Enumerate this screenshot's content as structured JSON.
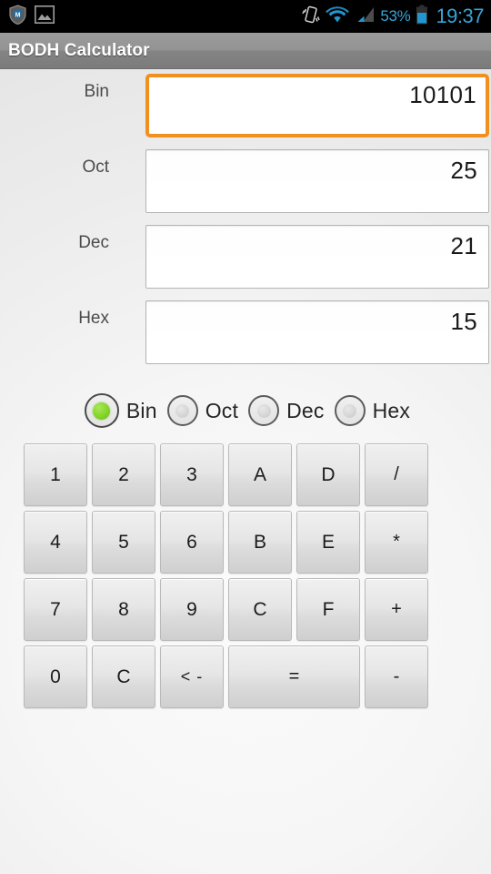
{
  "statusbar": {
    "left_icons": [
      {
        "name": "shield-security-icon",
        "glyph": "shield"
      },
      {
        "name": "photo-gallery-icon",
        "glyph": "photo"
      }
    ],
    "right_icons": [
      {
        "name": "vibrate-icon",
        "glyph": "vibrate"
      },
      {
        "name": "wifi-icon",
        "glyph": "wifi"
      },
      {
        "name": "cellular-signal-icon",
        "glyph": "signal"
      }
    ],
    "battery_percent": "53%",
    "battery_icon": "battery-icon",
    "clock": "19:37",
    "accent_color": "#36a5d8",
    "background_color": "#000000"
  },
  "actionbar": {
    "title": "BODH Calculator",
    "background_gradient_top": "#9b9b9b",
    "background_gradient_bottom": "#7b7b7b",
    "title_color": "#ffffff"
  },
  "fields": [
    {
      "label": "Bin",
      "value": "10101",
      "focused": true,
      "name": "binary-field"
    },
    {
      "label": "Oct",
      "value": "25",
      "focused": false,
      "name": "octal-field"
    },
    {
      "label": "Dec",
      "value": "21",
      "focused": false,
      "name": "decimal-field"
    },
    {
      "label": "Hex",
      "value": "15",
      "focused": false,
      "name": "hex-field"
    }
  ],
  "focus_border_color": "#f0901f",
  "radios": {
    "selected": "Bin",
    "selected_color": "#84d42a",
    "options": [
      {
        "label": "Bin",
        "selected": true,
        "name": "radio-bin"
      },
      {
        "label": "Oct",
        "selected": false,
        "name": "radio-oct"
      },
      {
        "label": "Dec",
        "selected": false,
        "name": "radio-dec"
      },
      {
        "label": "Hex",
        "selected": false,
        "name": "radio-hex"
      }
    ]
  },
  "keypad": {
    "rows": [
      [
        {
          "label": "1",
          "name": "key-1",
          "wide": false
        },
        {
          "label": "2",
          "name": "key-2",
          "wide": false
        },
        {
          "label": "3",
          "name": "key-3",
          "wide": false
        },
        {
          "label": "A",
          "name": "key-a",
          "wide": false
        },
        {
          "label": "D",
          "name": "key-d",
          "wide": false
        },
        {
          "label": "/",
          "name": "key-divide",
          "wide": false
        }
      ],
      [
        {
          "label": "4",
          "name": "key-4",
          "wide": false
        },
        {
          "label": "5",
          "name": "key-5",
          "wide": false
        },
        {
          "label": "6",
          "name": "key-6",
          "wide": false
        },
        {
          "label": "B",
          "name": "key-b",
          "wide": false
        },
        {
          "label": "E",
          "name": "key-e",
          "wide": false
        },
        {
          "label": "*",
          "name": "key-multiply",
          "wide": false
        }
      ],
      [
        {
          "label": "7",
          "name": "key-7",
          "wide": false
        },
        {
          "label": "8",
          "name": "key-8",
          "wide": false
        },
        {
          "label": "9",
          "name": "key-9",
          "wide": false
        },
        {
          "label": "C",
          "name": "key-c",
          "wide": false
        },
        {
          "label": "F",
          "name": "key-f",
          "wide": false
        },
        {
          "label": "+",
          "name": "key-plus",
          "wide": false
        }
      ],
      [
        {
          "label": "0",
          "name": "key-0",
          "wide": false
        },
        {
          "label": "C",
          "name": "key-clear",
          "wide": false
        },
        {
          "label": "< -",
          "name": "key-backspace",
          "wide": false
        },
        {
          "label": "=",
          "name": "key-equals",
          "wide": true
        },
        {
          "label": "-",
          "name": "key-minus",
          "wide": false
        }
      ]
    ]
  }
}
